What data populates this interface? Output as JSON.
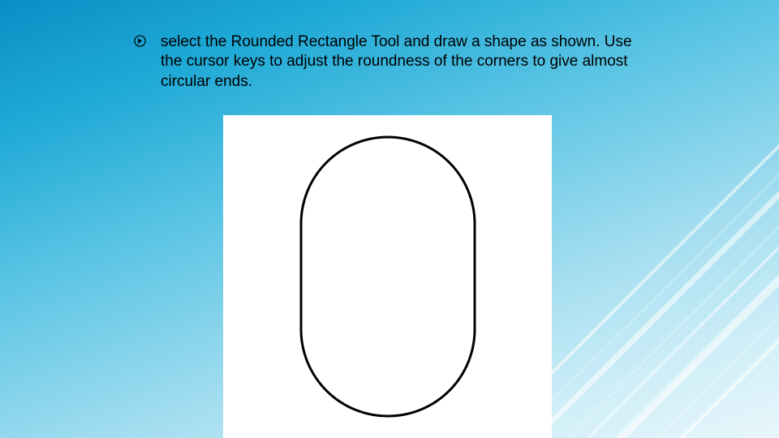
{
  "slide": {
    "bullet_icon": "circled-arrow-icon",
    "body_text": "select the Rounded Rectangle Tool and draw a shape as shown. Use the cursor keys to adjust the roundness of the corners to give almost circular ends.",
    "shape": {
      "alt": "rounded-rectangle-pill-outline",
      "stroke": "#000000",
      "stroke_width": 3,
      "fill": "none"
    },
    "decoration": {
      "line_color": "rgba(255,255,255,0.55)",
      "line_color_soft": "rgba(255,255,255,0.30)"
    }
  }
}
